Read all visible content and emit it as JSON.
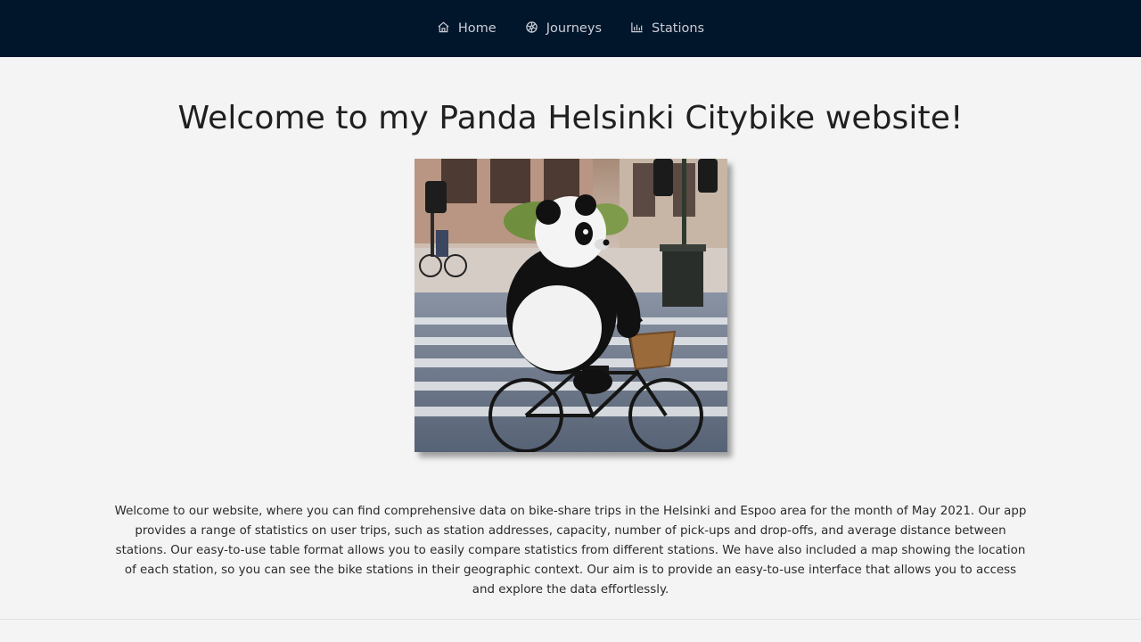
{
  "nav": {
    "items": [
      {
        "label": "Home",
        "icon": "home-icon"
      },
      {
        "label": "Journeys",
        "icon": "bike-wheel-icon"
      },
      {
        "label": "Stations",
        "icon": "bar-chart-icon"
      }
    ]
  },
  "main": {
    "title": "Welcome to my Panda Helsinki Citybike website!",
    "intro": "Welcome to our website, where you can find comprehensive data on bike-share trips in the Helsinki and Espoo area for the month of May 2021. Our app provides a range of statistics on user trips, such as station addresses, capacity, number of pick-ups and drop-offs, and average distance between stations. Our easy-to-use table format allows you to easily compare statistics from different stations. We have also included a map showing the location of each station, so you can see the bike stations in their geographic context. Our aim is to provide an easy-to-use interface that allows you to access and explore the data effortlessly."
  },
  "colors": {
    "navbar_bg": "#01152b",
    "nav_text": "#c9ced6",
    "page_bg": "#f4f4f4"
  }
}
